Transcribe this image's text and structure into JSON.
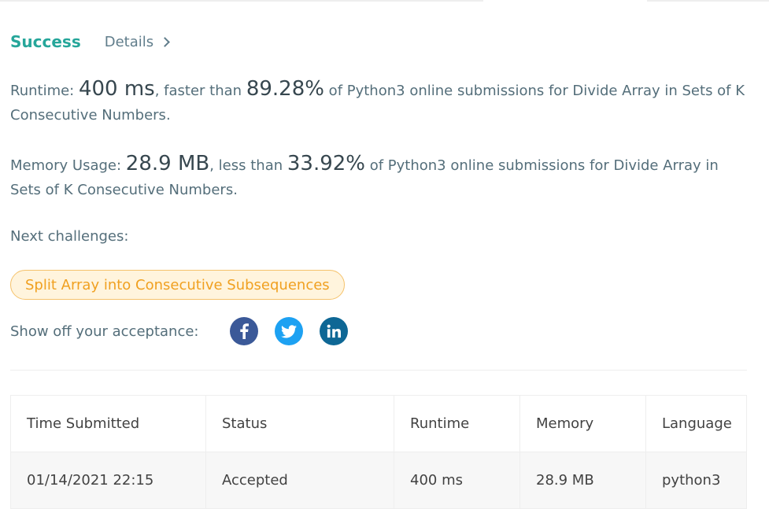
{
  "header": {
    "status": "Success",
    "details_label": "Details"
  },
  "runtime": {
    "label": "Runtime: ",
    "value": "400 ms",
    "mid": ", faster than ",
    "percent": "89.28%",
    "tail": " of Python3 online submissions for Divide Array in Sets of K Consecutive Numbers."
  },
  "memory": {
    "label": "Memory Usage: ",
    "value": "28.9 MB",
    "mid": ", less than ",
    "percent": "33.92%",
    "tail": " of Python3 online submissions for Divide Array in Sets of K Consecutive Numbers."
  },
  "next": {
    "label": "Next challenges:",
    "challenge": "Split Array into Consecutive Subsequences"
  },
  "share": {
    "label": "Show off your acceptance:",
    "icons": [
      "facebook-icon",
      "twitter-icon",
      "linkedin-icon"
    ]
  },
  "colors": {
    "success": "#26a69a",
    "challenge_text": "#f0a020",
    "challenge_bg": "#fff4dd",
    "facebook": "#3b5998",
    "twitter": "#1da1f2",
    "linkedin": "#0e6795"
  },
  "table": {
    "headers": [
      "Time Submitted",
      "Status",
      "Runtime",
      "Memory",
      "Language"
    ],
    "rows": [
      [
        "01/14/2021 22:15",
        "Accepted",
        "400 ms",
        "28.9 MB",
        "python3"
      ]
    ]
  }
}
